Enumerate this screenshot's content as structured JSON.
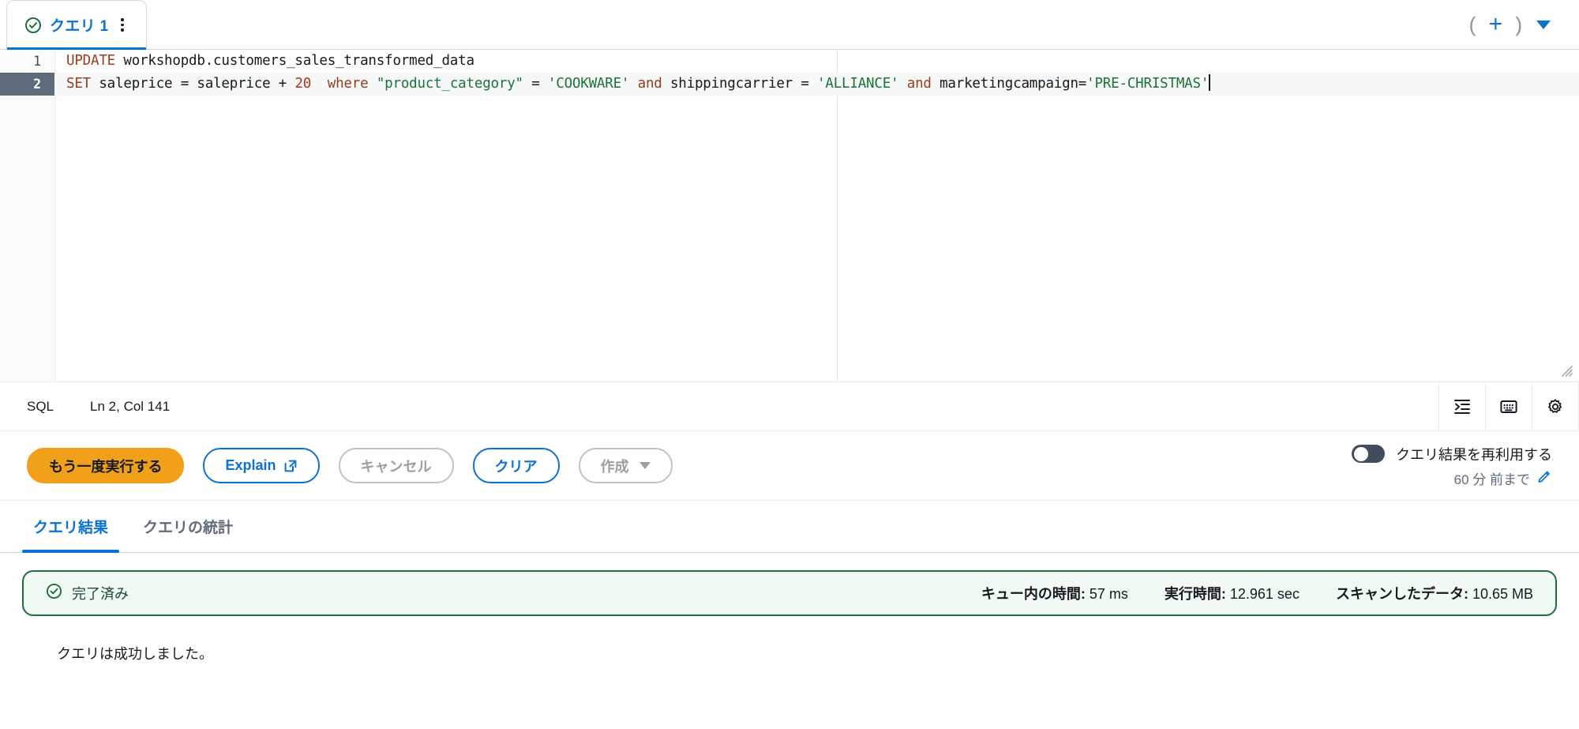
{
  "tabstrip": {
    "tab": {
      "label": "クエリ 1",
      "status_icon": "check-circle-icon",
      "menu_icon": "kebab-menu-icon"
    },
    "left_paren": "(",
    "right_paren": ")",
    "add_tab_label": "+",
    "caret_icon": "chevron-down-icon"
  },
  "editor": {
    "language": "SQL",
    "cursor_position": "Ln 2, Col 141",
    "lines": [
      {
        "number": "1",
        "active": false,
        "tokens": [
          {
            "text": "UPDATE",
            "type": "kw"
          },
          {
            "text": " ",
            "type": "op"
          },
          {
            "text": "workshopdb.customers_sales_transformed_data",
            "type": "id"
          }
        ]
      },
      {
        "number": "2",
        "active": true,
        "tokens": [
          {
            "text": "SET",
            "type": "kw"
          },
          {
            "text": " saleprice ",
            "type": "id"
          },
          {
            "text": "=",
            "type": "op"
          },
          {
            "text": " saleprice ",
            "type": "id"
          },
          {
            "text": "+",
            "type": "op"
          },
          {
            "text": " ",
            "type": "op"
          },
          {
            "text": "20",
            "type": "num"
          },
          {
            "text": "  ",
            "type": "op"
          },
          {
            "text": "where",
            "type": "kw"
          },
          {
            "text": " ",
            "type": "op"
          },
          {
            "text": "\"product_category\"",
            "type": "qid"
          },
          {
            "text": " ",
            "type": "op"
          },
          {
            "text": "=",
            "type": "op"
          },
          {
            "text": " ",
            "type": "op"
          },
          {
            "text": "'COOKWARE'",
            "type": "str"
          },
          {
            "text": " ",
            "type": "op"
          },
          {
            "text": "and",
            "type": "kw"
          },
          {
            "text": " shippingcarrier ",
            "type": "id"
          },
          {
            "text": "=",
            "type": "op"
          },
          {
            "text": " ",
            "type": "op"
          },
          {
            "text": "'ALLIANCE'",
            "type": "str"
          },
          {
            "text": " ",
            "type": "op"
          },
          {
            "text": "and",
            "type": "kw"
          },
          {
            "text": " marketingcampaign",
            "type": "id"
          },
          {
            "text": "=",
            "type": "op"
          },
          {
            "text": "'PRE-CHRISTMAS'",
            "type": "str"
          }
        ]
      }
    ],
    "full_text": "UPDATE workshopdb.customers_sales_transformed_data\nSET saleprice = saleprice + 20  where \"product_category\" = 'COOKWARE' and shippingcarrier = 'ALLIANCE' and marketingcampaign='PRE-CHRISTMAS'",
    "resize_handle_icon": "resize-grip-icon",
    "status_icons": [
      {
        "name": "format-query-icon"
      },
      {
        "name": "keyboard-shortcuts-icon"
      },
      {
        "name": "editor-settings-gear-icon"
      }
    ]
  },
  "actions": {
    "run_again": "もう一度実行する",
    "explain": "Explain",
    "explain_icon": "external-link-icon",
    "cancel": "キャンセル",
    "clear": "クリア",
    "create": "作成",
    "create_caret_icon": "chevron-down-icon",
    "reuse_toggle_label": "クエリ結果を再利用する",
    "reuse_toggle_state": "off",
    "reuse_window": "60 分 前まで",
    "reuse_edit_icon": "pencil-edit-icon"
  },
  "result_tabs": [
    {
      "label": "クエリ結果",
      "active": true
    },
    {
      "label": "クエリの統計",
      "active": false
    }
  ],
  "result_alert": {
    "icon": "check-circle-icon",
    "status": "完了済み",
    "metrics": [
      {
        "label": "キュー内の時間:",
        "value": "57 ms"
      },
      {
        "label": "実行時間:",
        "value": "12.961 sec"
      },
      {
        "label": "スキャンしたデータ:",
        "value": "10.65 MB"
      }
    ]
  },
  "result_message": "クエリは成功しました。",
  "colors": {
    "accent_blue": "#0972d3",
    "primary_orange": "#f0a019",
    "success_green": "#1a7336",
    "success_bg": "#f2faf4",
    "keyword": "#9a3b1b",
    "string": "#1a7336",
    "number": "#b5341f",
    "active_line_gutter": "#5f6b7a"
  }
}
